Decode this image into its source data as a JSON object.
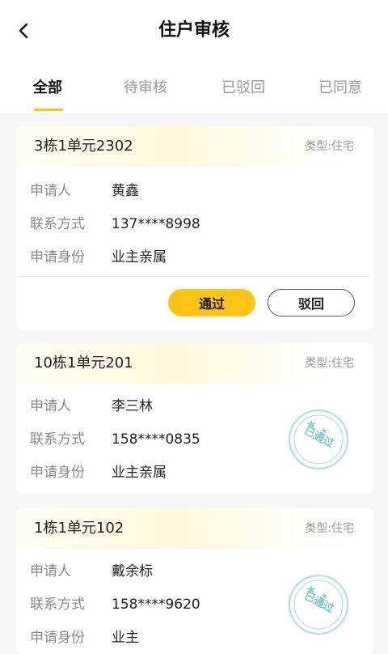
{
  "header": {
    "title": "住户审核"
  },
  "tabs": [
    {
      "label": "全部"
    },
    {
      "label": "待审核"
    },
    {
      "label": "已驳回"
    },
    {
      "label": "已同意"
    }
  ],
  "labels": {
    "applicant": "申请人",
    "contact": "联系方式",
    "identity": "申请身份"
  },
  "actions": {
    "approve": "通过",
    "reject": "驳回"
  },
  "cards": [
    {
      "unit": "3栋1单元2302",
      "type": "类型:住宅",
      "applicant": "黄鑫",
      "contact": "137****8998",
      "identity": "业主亲属",
      "status": "pending"
    },
    {
      "unit": "10栋1单元201",
      "type": "类型:住宅",
      "applicant": "李三林",
      "contact": "158****0835",
      "identity": "业主亲属",
      "status": "approved",
      "stamp": "已通过"
    },
    {
      "unit": "1栋1单元102",
      "type": "类型:住宅",
      "applicant": "戴余标",
      "contact": "158****9620",
      "identity": "业主",
      "status": "approved",
      "stamp": "已通过"
    }
  ],
  "colors": {
    "accent": "#fcc419",
    "stamp": "#7cc6cf",
    "muted": "#8a8a8a"
  }
}
